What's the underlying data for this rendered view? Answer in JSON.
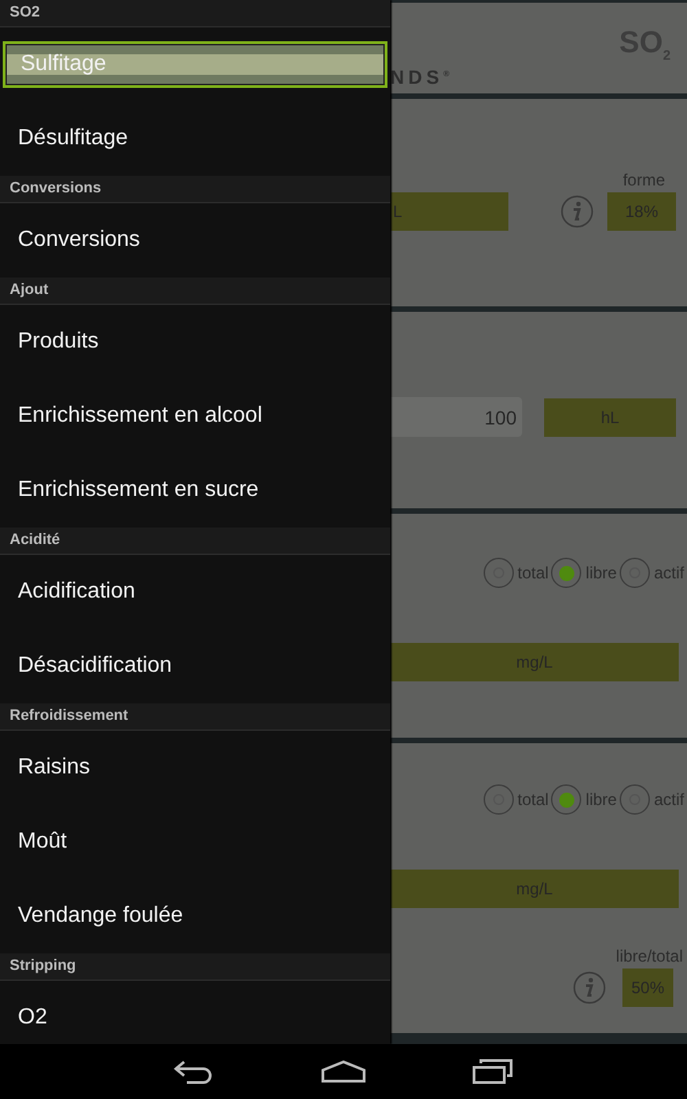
{
  "drawer": {
    "sections": [
      {
        "title": "SO2",
        "items": [
          {
            "label": "Sulfitage",
            "selected": true
          },
          {
            "label": "Désulfitage",
            "selected": false
          }
        ]
      },
      {
        "title": "Conversions",
        "items": [
          {
            "label": "Conversions",
            "selected": false
          }
        ]
      },
      {
        "title": "Ajout",
        "items": [
          {
            "label": "Produits",
            "selected": false
          },
          {
            "label": "Enrichissement en alcool",
            "selected": false
          },
          {
            "label": "Enrichissement en sucre",
            "selected": false
          }
        ]
      },
      {
        "title": "Acidité",
        "items": [
          {
            "label": "Acidification",
            "selected": false
          },
          {
            "label": "Désacidification",
            "selected": false
          }
        ]
      },
      {
        "title": "Refroidissement",
        "items": [
          {
            "label": "Raisins",
            "selected": false
          },
          {
            "label": "Moût",
            "selected": false
          },
          {
            "label": "Vendange foulée",
            "selected": false
          }
        ]
      },
      {
        "title": "Stripping",
        "items": [
          {
            "label": "O2",
            "selected": false
          }
        ]
      }
    ]
  },
  "header": {
    "title": "SO$_{2}$",
    "logo": "NDS$^{®}$"
  },
  "cards": [
    {
      "kind": "form",
      "field": "L",
      "label": "forme",
      "value": "18%"
    },
    {
      "kind": "volume",
      "input": "100",
      "unit": "hL"
    },
    {
      "kind": "radio",
      "options": [
        {
          "label": "total",
          "selected": false
        },
        {
          "label": "libre",
          "selected": true
        },
        {
          "label": "actif",
          "selected": false
        }
      ],
      "unit": "mg/L"
    },
    {
      "kind": "radio_ratio",
      "options": [
        {
          "label": "total",
          "selected": false
        },
        {
          "label": "libre",
          "selected": true
        },
        {
          "label": "actif",
          "selected": false
        }
      ],
      "unit": "mg/L",
      "label": "libre/total",
      "value": "50%"
    }
  ]
}
